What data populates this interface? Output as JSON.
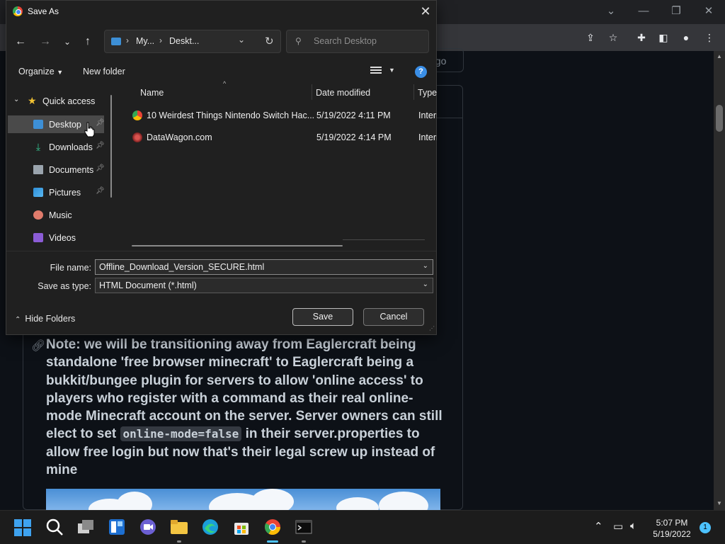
{
  "dialog": {
    "title": "Save As",
    "breadcrumb": [
      "My...",
      "Deskt..."
    ],
    "search_placeholder": "Search Desktop",
    "commands": {
      "organize": "Organize",
      "new_folder": "New folder",
      "help": "?"
    },
    "nav": {
      "quick_access": "Quick access",
      "items": [
        {
          "label": "Desktop",
          "pinned": true,
          "selected": true
        },
        {
          "label": "Downloads",
          "pinned": true
        },
        {
          "label": "Documents",
          "pinned": true
        },
        {
          "label": "Pictures",
          "pinned": true
        },
        {
          "label": "Music",
          "pinned": false
        },
        {
          "label": "Videos",
          "pinned": false
        }
      ]
    },
    "columns": {
      "name": "Name",
      "date": "Date modified",
      "type": "Type"
    },
    "files": [
      {
        "name": "10 Weirdest Things Nintendo Switch Hac...",
        "date": "5/19/2022 4:11 PM",
        "type": "Internet Shortcut"
      },
      {
        "name": "DataWagon.com",
        "date": "5/19/2022 4:14 PM",
        "type": "Internet Shortcut"
      }
    ],
    "file_name_label": "File name:",
    "file_name_value": "Offline_Download_Version_SECURE.html",
    "save_type_label": "Save as type:",
    "save_type_value": "HTML Document (*.html)",
    "hide_folders": "Hide Folders",
    "save_button": "Save",
    "cancel_button": "Cancel"
  },
  "page": {
    "partial_tab": "ago",
    "note_parts": {
      "before_code": "Note: we will be transitioning away from Eaglercraft being standalone 'free browser minecraft' to Eaglercraft being a bukkit/bungee plugin for servers to allow 'online access' to players who register with a command as their real online-mode Minecraft account on the server. Server owners can still elect to set ",
      "code": "online-mode=false",
      "after_code": " in their server.properties to allow free login but now that's their legal screw up instead of mine"
    }
  },
  "taskbar": {
    "time": "5:07 PM",
    "date": "5/19/2022",
    "notifications": "1"
  },
  "colors": {
    "accent": "#4cc2ff",
    "dialog_bg": "#202020",
    "page_bg": "#0d1117",
    "help_blue": "#3a8ee6"
  }
}
